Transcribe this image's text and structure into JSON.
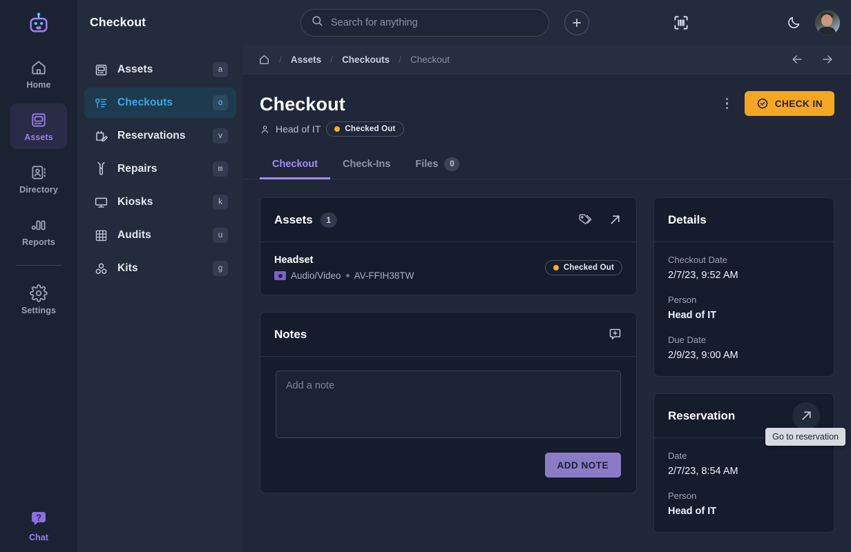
{
  "rail": {
    "logo_icon": "robot-logo-icon",
    "items": [
      {
        "label": "Home",
        "icon": "home-icon",
        "active": false
      },
      {
        "label": "Assets",
        "icon": "assets-icon",
        "active": true
      },
      {
        "label": "Directory",
        "icon": "directory-icon",
        "active": false
      },
      {
        "label": "Reports",
        "icon": "reports-icon",
        "active": false
      },
      {
        "label": "Settings",
        "icon": "gear-icon",
        "active": false
      }
    ],
    "chat": {
      "label": "Chat",
      "icon": "chat-help-icon"
    }
  },
  "topbar": {
    "title": "Checkout",
    "search_placeholder": "Search for anything",
    "search_value": "",
    "search_icon": "search-icon",
    "add_icon": "plus-icon",
    "scan_icon": "barcode-scan-icon",
    "theme_icon": "moon-icon",
    "avatar_icon": "user-avatar"
  },
  "subnav": {
    "items": [
      {
        "label": "Assets",
        "key": "a",
        "icon": "assets-icon",
        "active": false
      },
      {
        "label": "Checkouts",
        "key": "o",
        "icon": "checkouts-icon",
        "active": true
      },
      {
        "label": "Reservations",
        "key": "v",
        "icon": "reservations-icon",
        "active": false
      },
      {
        "label": "Repairs",
        "key": "m",
        "icon": "wrench-icon",
        "active": false
      },
      {
        "label": "Kiosks",
        "key": "k",
        "icon": "monitor-icon",
        "active": false
      },
      {
        "label": "Audits",
        "key": "u",
        "icon": "grid-icon",
        "active": false
      },
      {
        "label": "Kits",
        "key": "g",
        "icon": "boxes-icon",
        "active": false
      }
    ]
  },
  "breadcrumb": {
    "home_icon": "home-icon",
    "separator": "/",
    "items": [
      "Assets",
      "Checkouts",
      "Checkout"
    ],
    "back_icon": "arrow-left-icon",
    "forward_icon": "arrow-right-icon"
  },
  "page": {
    "title": "Checkout",
    "person": "Head of IT",
    "person_icon": "person-icon",
    "status": "Checked Out",
    "status_color": "#f0b429",
    "kebab_icon": "more-vertical-icon",
    "checkin_label": "CHECK IN",
    "checkin_icon": "verified-check-icon",
    "checkin_color": "#f5a623"
  },
  "tabs": [
    {
      "label": "Checkout",
      "count": null,
      "active": true
    },
    {
      "label": "Check-Ins",
      "count": null,
      "active": false
    },
    {
      "label": "Files",
      "count": "0",
      "active": false
    }
  ],
  "assets_card": {
    "title": "Assets",
    "count": "1",
    "tag_icon": "tags-icon",
    "open_icon": "external-link-icon",
    "rows": [
      {
        "name": "Headset",
        "category": "Audio/Video",
        "category_icon": "category-icon",
        "separator": "•",
        "code": "AV-FFIH38TW",
        "status": "Checked Out",
        "status_color": "#f0b429"
      }
    ]
  },
  "notes_card": {
    "title": "Notes",
    "add_icon": "add-comment-icon",
    "textarea_placeholder": "Add a note",
    "textarea_value": "",
    "add_button_label": "ADD NOTE"
  },
  "details_card": {
    "title": "Details",
    "fields": [
      {
        "label": "Checkout Date",
        "value": "2/7/23, 9:52 AM",
        "bold": false
      },
      {
        "label": "Person",
        "value": "Head of IT",
        "bold": true
      },
      {
        "label": "Due Date",
        "value": "2/9/23, 9:00 AM",
        "bold": false
      }
    ]
  },
  "reservation_card": {
    "title": "Reservation",
    "open_icon": "external-link-icon",
    "tooltip": "Go to reservation",
    "fields": [
      {
        "label": "Date",
        "value": "2/7/23, 8:54 AM"
      },
      {
        "label": "Person",
        "value": "Head of IT"
      }
    ]
  }
}
